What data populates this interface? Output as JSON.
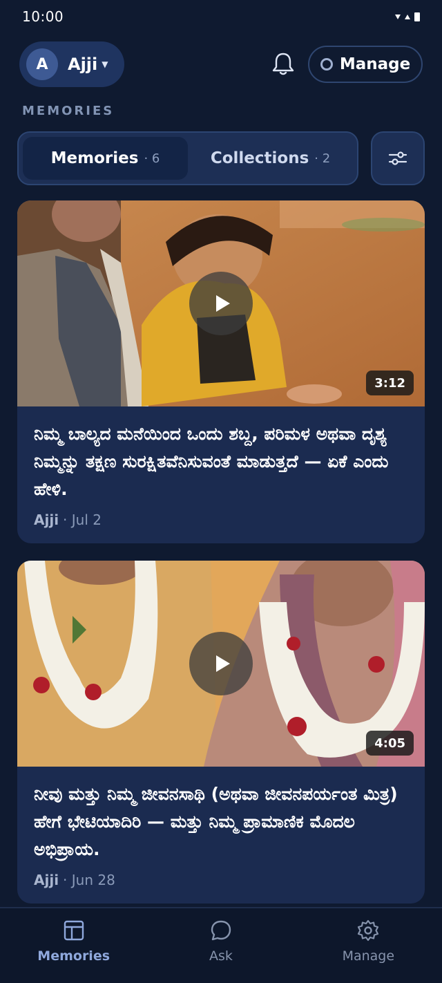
{
  "status": {
    "time": "10:00"
  },
  "header": {
    "avatar_initial": "A",
    "user_name": "Ajji",
    "manage_label": "Manage"
  },
  "section_label": "MEMORIES",
  "tabs": [
    {
      "label": "Memories",
      "count": "· 6",
      "active": true
    },
    {
      "label": "Collections",
      "count": "· 2",
      "active": false
    }
  ],
  "memories": [
    {
      "prompt": "ನಿಮ್ಮ ಬಾಲ್ಯದ ಮನೆಯಿಂದ ಒಂದು ಶಬ್ದ, ಪರಿಮಳ ಅಥವಾ ದೃಶ್ಯ ನಿಮ್ಮನ್ನು ತಕ್ಷಣ ಸುರಕ್ಷಿತವೆನಿಸುವಂತೆ ಮಾಡುತ್ತದೆ — ಏಕೆ ಎಂದು ಹೇಳಿ.",
      "author": "Ajji",
      "date": "· Jul 2",
      "duration": "3:12"
    },
    {
      "prompt": "ನೀವು ಮತ್ತು ನಿಮ್ಮ ಜೀವನಸಾಥಿ (ಅಥವಾ ಜೀವನಪರ್ಯಂತ ಮಿತ್ರ) ಹೇಗೆ ಭೇಟಿಯಾದಿರಿ — ಮತ್ತು ನಿಮ್ಮ ಪ್ರಾಮಾಣಿಕ ಮೊದಲ ಅಭಿಪ್ರಾಯ.",
      "author": "Ajji",
      "date": "· Jun 28",
      "duration": "4:05"
    }
  ],
  "nav": [
    {
      "label": "Memories",
      "icon": "layout-icon",
      "active": true
    },
    {
      "label": "Ask",
      "icon": "chat-bubble-icon",
      "active": false
    },
    {
      "label": "Manage",
      "icon": "gear-icon",
      "active": false
    }
  ]
}
